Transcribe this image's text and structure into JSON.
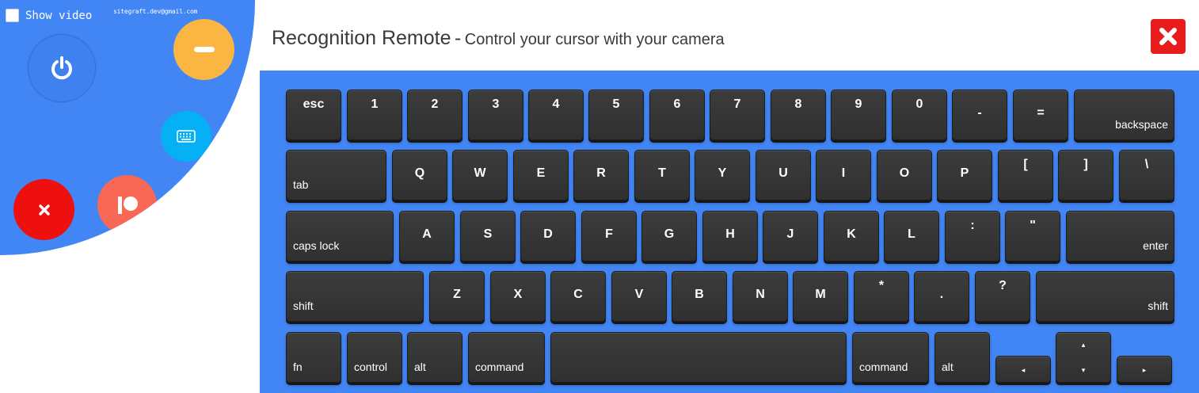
{
  "panel": {
    "show_video_label": "Show video",
    "show_video_checked": false,
    "email": "sitegraft.dev@gmail.com",
    "buttons": {
      "power": "power-icon",
      "minimize": "minus-icon",
      "keyboard": "keyboard-icon",
      "patreon": "patreon-icon",
      "close": "close-icon"
    },
    "colors": {
      "panel_bg": "#4285f4",
      "minimize": "#fbb542",
      "keyboard": "#05b0f5",
      "patreon": "#f96854",
      "close": "#ee0f0f"
    }
  },
  "header": {
    "title": "Recognition Remote",
    "separator": "-",
    "subtitle": "Control your cursor with your camera",
    "close_icon": "close-icon",
    "close_color": "#e81c1c"
  },
  "keyboard": {
    "bg_color": "#4285f4",
    "key_color": "#333333",
    "row1": [
      "esc",
      "1",
      "2",
      "3",
      "4",
      "5",
      "6",
      "7",
      "8",
      "9",
      "0",
      "-",
      "=",
      "backspace"
    ],
    "row2": [
      "tab",
      "Q",
      "W",
      "E",
      "R",
      "T",
      "Y",
      "U",
      "I",
      "O",
      "P",
      "[",
      "]",
      "\\"
    ],
    "row3": [
      "caps lock",
      "A",
      "S",
      "D",
      "F",
      "G",
      "H",
      "J",
      "K",
      "L",
      ":",
      "\"",
      "enter"
    ],
    "row4": [
      "shift",
      "Z",
      "X",
      "C",
      "V",
      "B",
      "N",
      "M",
      "*",
      ".",
      "?",
      "shift"
    ],
    "row5": [
      "fn",
      "control",
      "alt",
      "command",
      "",
      "command",
      "alt"
    ],
    "arrows": {
      "left": "◂",
      "up": "▴",
      "down": "▾",
      "right": "▸"
    }
  }
}
